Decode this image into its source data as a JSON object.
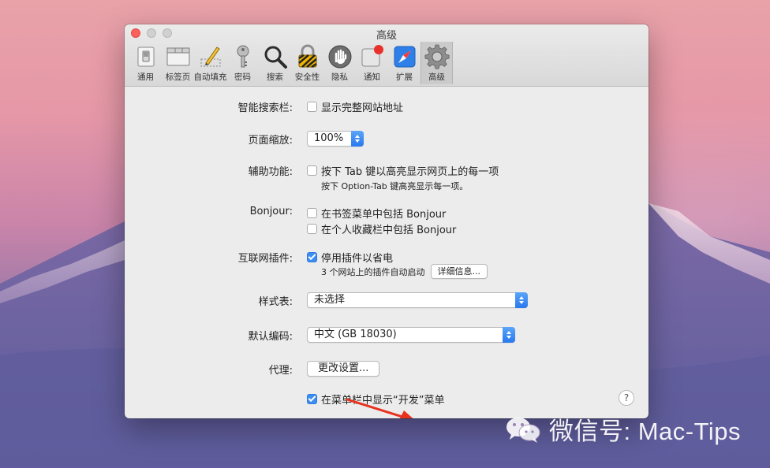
{
  "window": {
    "title": "高级"
  },
  "toolbar": {
    "items": [
      {
        "label": "通用",
        "icon": "switch-icon"
      },
      {
        "label": "标签页",
        "icon": "tabs-icon"
      },
      {
        "label": "自动填充",
        "icon": "pencil-icon"
      },
      {
        "label": "密码",
        "icon": "key-icon"
      },
      {
        "label": "搜索",
        "icon": "magnifier-icon"
      },
      {
        "label": "安全性",
        "icon": "lock-icon"
      },
      {
        "label": "隐私",
        "icon": "hand-icon"
      },
      {
        "label": "通知",
        "icon": "notification-icon"
      },
      {
        "label": "扩展",
        "icon": "compass-icon"
      },
      {
        "label": "高级",
        "icon": "gear-icon"
      }
    ],
    "selected": "高级"
  },
  "settings": {
    "smart_search": {
      "label": "智能搜索栏:",
      "checkbox": "显示完整网站地址",
      "checked": false
    },
    "zoom": {
      "label": "页面缩放:",
      "value": "100%"
    },
    "accessibility": {
      "label": "辅助功能:",
      "checkbox": "按下 Tab 键以高亮显示网页上的每一项",
      "checked": false,
      "note": "按下 Option-Tab 键高亮显示每一项。"
    },
    "bonjour": {
      "label": "Bonjour:",
      "option1": "在书签菜单中包括 Bonjour",
      "option2": "在个人收藏栏中包括 Bonjour"
    },
    "plugins": {
      "label": "互联网插件:",
      "checkbox": "停用插件以省电",
      "checked": true,
      "note": "3 个网站上的插件自动启动",
      "details_button": "详细信息..."
    },
    "stylesheet": {
      "label": "样式表:",
      "value": "未选择"
    },
    "encoding": {
      "label": "默认编码:",
      "value": "中文 (GB 18030)"
    },
    "proxy": {
      "label": "代理:",
      "button": "更改设置..."
    },
    "develop": {
      "checkbox": "在菜单栏中显示“开发”菜单",
      "checked": true
    },
    "help": "?"
  },
  "watermark": {
    "text": "微信号: Mac-Tips"
  },
  "colors": {
    "accent": "#3d8ef4",
    "arrow": "#e8321e"
  }
}
